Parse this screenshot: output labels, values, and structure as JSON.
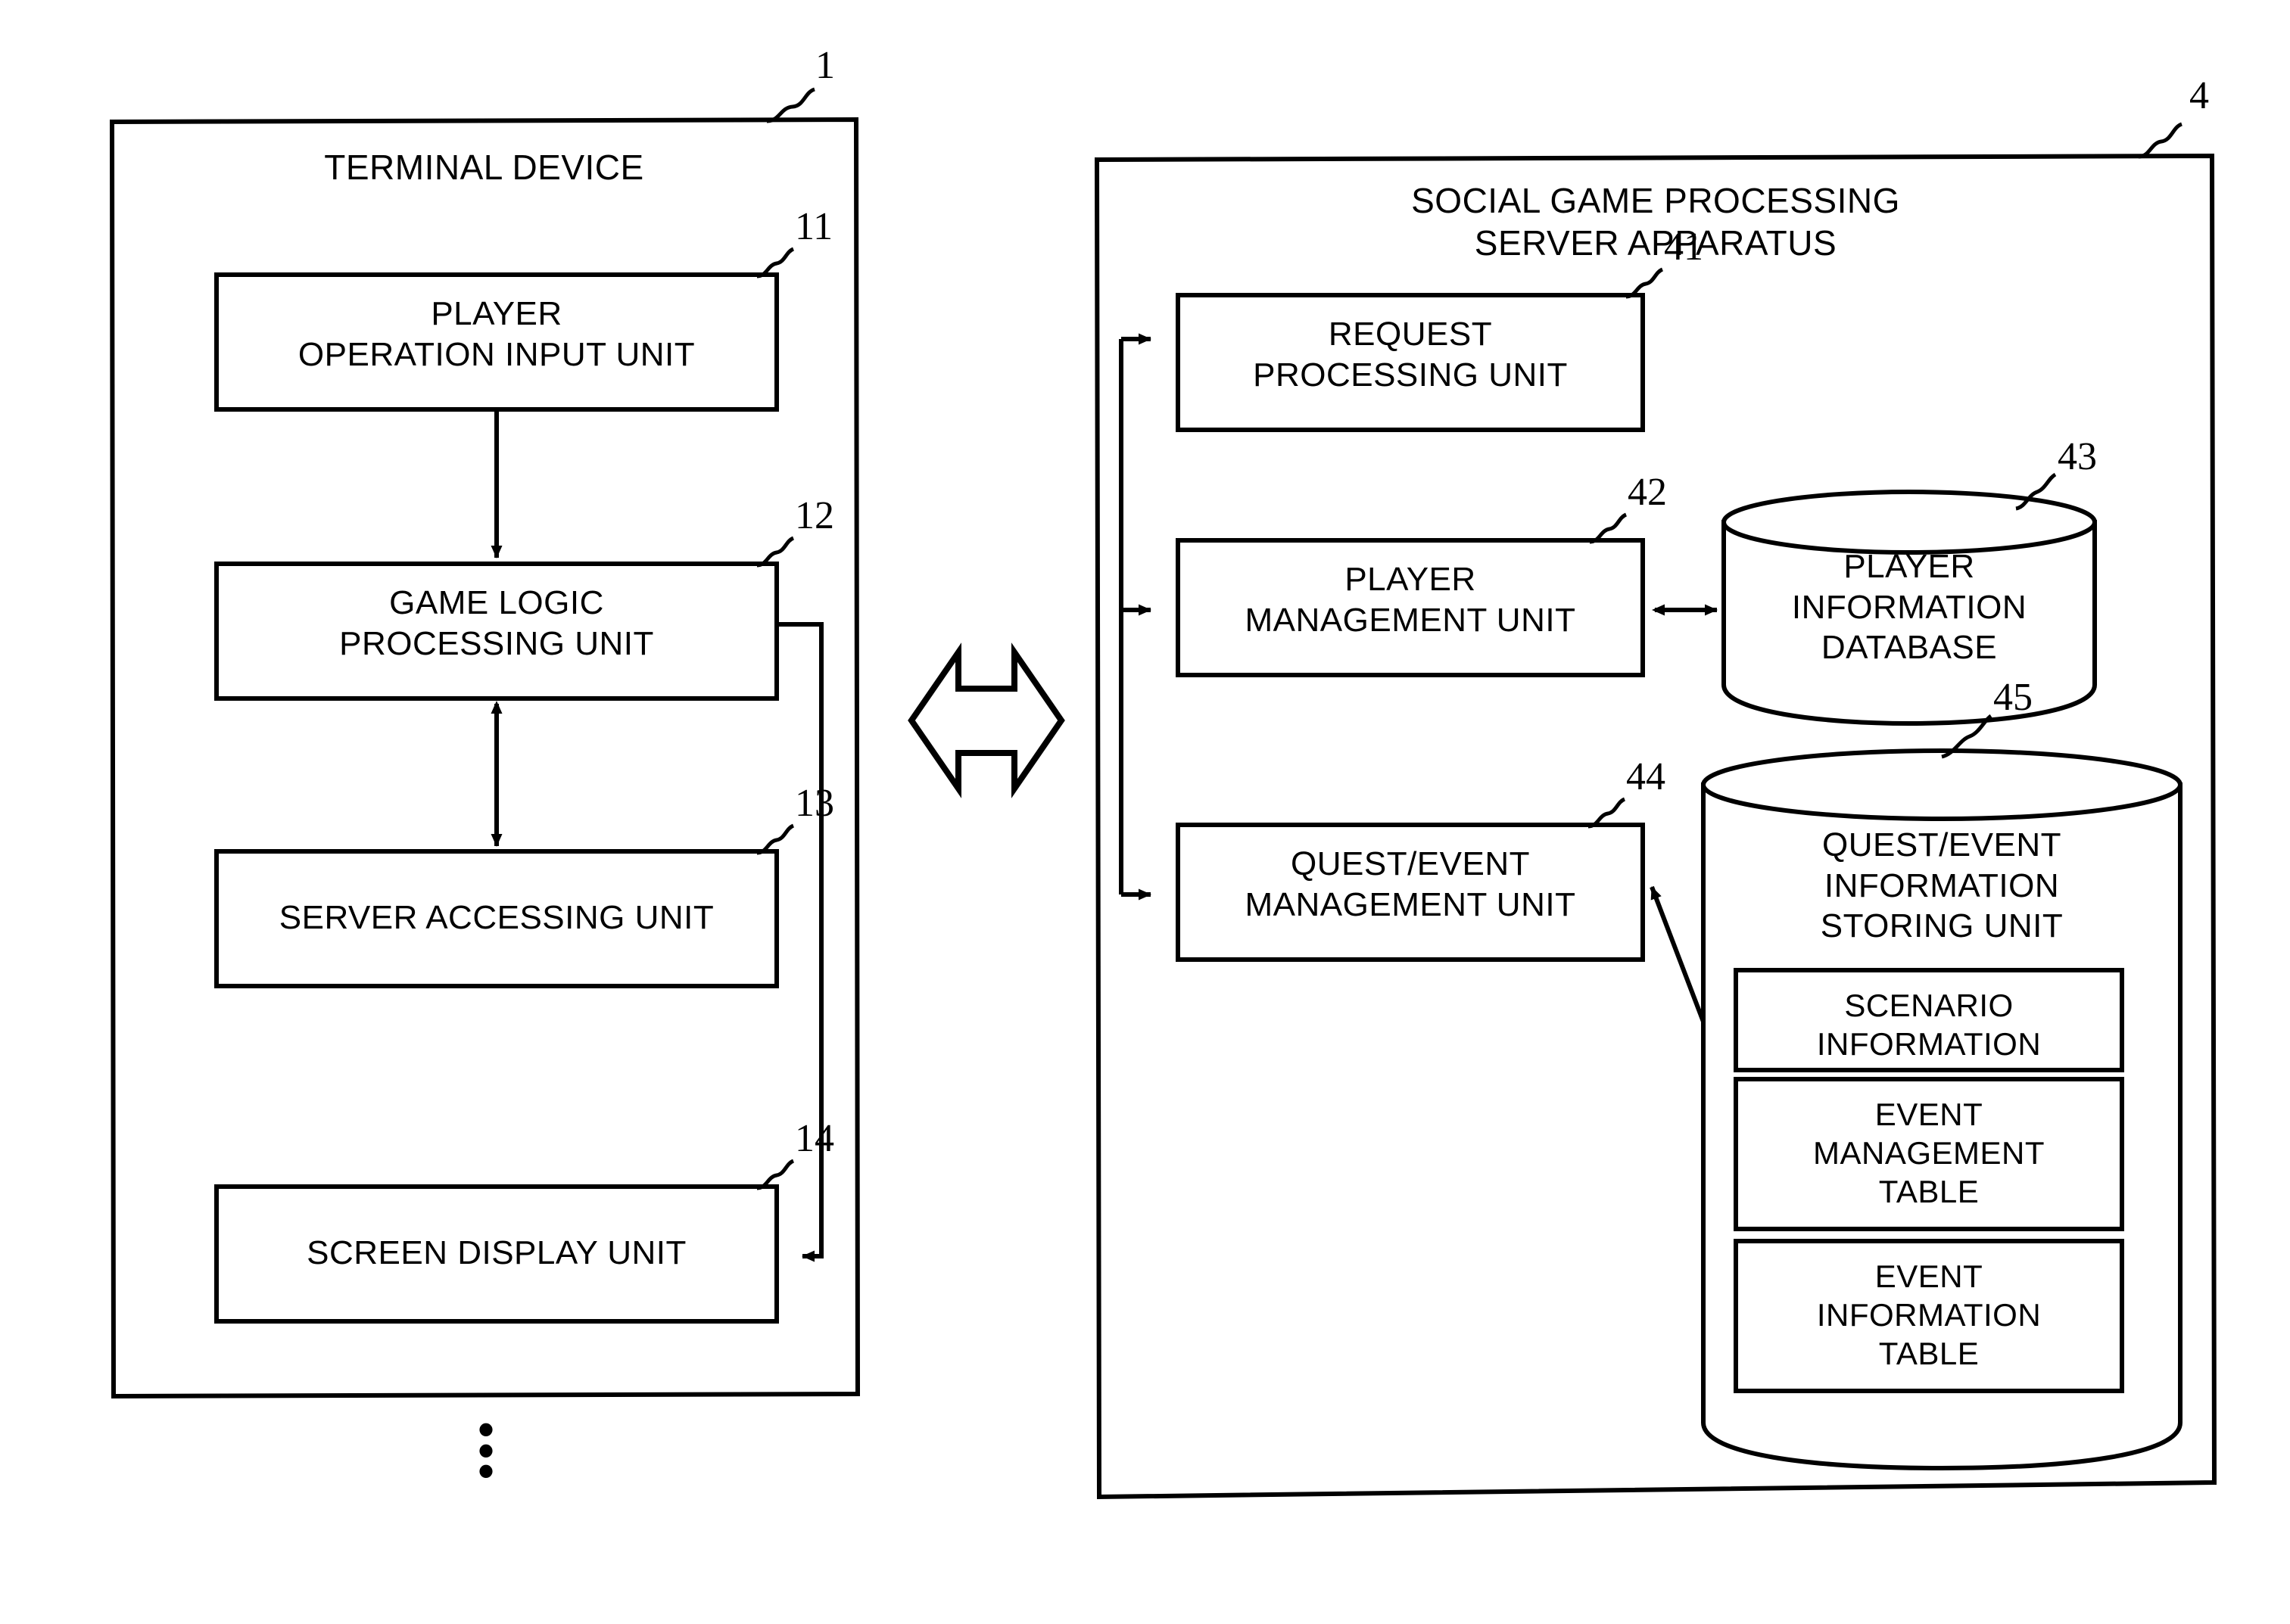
{
  "figure": {
    "type": "block-diagram",
    "left_panel": {
      "title": "TERMINAL DEVICE",
      "ref": "1",
      "blocks": [
        {
          "ref": "11",
          "label": "PLAYER\nOPERATION INPUT UNIT"
        },
        {
          "ref": "12",
          "label": "GAME LOGIC\nPROCESSING UNIT"
        },
        {
          "ref": "13",
          "label": "SERVER ACCESSING UNIT"
        },
        {
          "ref": "14",
          "label": "SCREEN DISPLAY UNIT"
        }
      ],
      "continuation_marker": "⋮"
    },
    "right_panel": {
      "title": "SOCIAL GAME PROCESSING\nSERVER APPARATUS",
      "ref": "4",
      "blocks": [
        {
          "ref": "41",
          "label": "REQUEST\nPROCESSING UNIT"
        },
        {
          "ref": "42",
          "label": "PLAYER\nMANAGEMENT UNIT"
        },
        {
          "ref": "44",
          "label": "QUEST/EVENT\nMANAGEMENT UNIT"
        }
      ],
      "stores": [
        {
          "ref": "43",
          "label": "PLAYER\nINFORMATION\nDATABASE",
          "shape": "cylinder"
        },
        {
          "ref": "45",
          "label": "QUEST/EVENT\nINFORMATION\nSTORING UNIT",
          "shape": "cylinder",
          "children": [
            {
              "label": "SCENARIO\nINFORMATION"
            },
            {
              "label": "EVENT\nMANAGEMENT\nTABLE"
            },
            {
              "label": "EVENT\nINFORMATION\nTABLE"
            }
          ]
        }
      ]
    },
    "connector": {
      "name": "bidirectional-block-arrow",
      "direction": "double"
    },
    "colors": {
      "line": "#000000",
      "background": "#ffffff",
      "text": "#000000"
    }
  }
}
